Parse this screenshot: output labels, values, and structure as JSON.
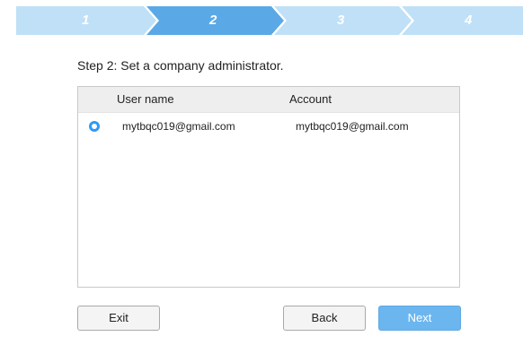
{
  "stepper": {
    "steps": [
      {
        "label": "1",
        "state": "done"
      },
      {
        "label": "2",
        "state": "active"
      },
      {
        "label": "3",
        "state": "pending"
      },
      {
        "label": "4",
        "state": "pending"
      }
    ],
    "colors": {
      "active": "#5aa9e6",
      "inactive": "#bfe0f7"
    }
  },
  "step_title": "Step 2: Set a company administrator.",
  "table": {
    "columns": [
      "User name",
      "Account"
    ],
    "rows": [
      {
        "selected": true,
        "user_name": "mytbqc019@gmail.com",
        "account": "mytbqc019@gmail.com"
      }
    ]
  },
  "buttons": {
    "exit": "Exit",
    "back": "Back",
    "next": "Next"
  },
  "accent_color": "#2f9af2"
}
